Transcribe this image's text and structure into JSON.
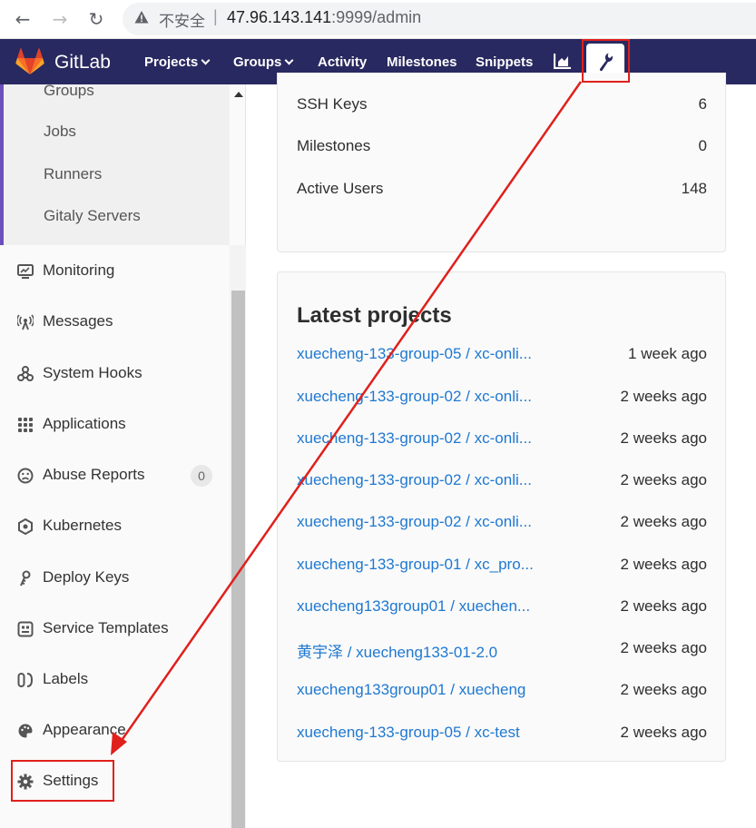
{
  "browser": {
    "insecure_label": "不安全",
    "separator": "|",
    "url_host": "47.96.143.141",
    "url_rest": ":9999/admin"
  },
  "header": {
    "brand": "GitLab",
    "nav": [
      {
        "label": "Projects",
        "has_caret": true
      },
      {
        "label": "Groups",
        "has_caret": true
      },
      {
        "label": "Activity"
      },
      {
        "label": "Milestones"
      },
      {
        "label": "Snippets"
      }
    ],
    "colors": {
      "background": "#292961",
      "logo_orange": "#e24329"
    }
  },
  "sidebar": {
    "sub_items": [
      "Groups",
      "Jobs",
      "Runners",
      "Gitaly Servers"
    ],
    "items": [
      {
        "label": "Monitoring",
        "icon": "monitor-icon"
      },
      {
        "label": "Messages",
        "icon": "broadcast-icon"
      },
      {
        "label": "System Hooks",
        "icon": "hook-icon"
      },
      {
        "label": "Applications",
        "icon": "grid-icon"
      },
      {
        "label": "Abuse Reports",
        "icon": "abuse-icon",
        "badge": "0"
      },
      {
        "label": "Kubernetes",
        "icon": "kubernetes-icon"
      },
      {
        "label": "Deploy Keys",
        "icon": "key-icon"
      },
      {
        "label": "Service Templates",
        "icon": "template-icon"
      },
      {
        "label": "Labels",
        "icon": "labels-icon"
      },
      {
        "label": "Appearance",
        "icon": "appearance-icon"
      },
      {
        "label": "Settings",
        "icon": "gear-icon"
      }
    ]
  },
  "stats": [
    {
      "label": "SSH Keys",
      "value": "6"
    },
    {
      "label": "Milestones",
      "value": "0"
    },
    {
      "label": "Active Users",
      "value": "148"
    }
  ],
  "latest_projects": {
    "title": "Latest projects",
    "rows": [
      {
        "name": "xuecheng-133-group-05 / xc-onli...",
        "time": "1 week ago"
      },
      {
        "name": "xuecheng-133-group-02 / xc-onli...",
        "time": "2 weeks ago"
      },
      {
        "name": "xuecheng-133-group-02 / xc-onli...",
        "time": "2 weeks ago"
      },
      {
        "name": "xuecheng-133-group-02 / xc-onli...",
        "time": "2 weeks ago"
      },
      {
        "name": "xuecheng-133-group-02 / xc-onli...",
        "time": "2 weeks ago"
      },
      {
        "name": "xuecheng-133-group-01 / xc_pro...",
        "time": "2 weeks ago"
      },
      {
        "name": "xuecheng133group01 / xuechen...",
        "time": "2 weeks ago"
      },
      {
        "name": "黄宇泽 / xuecheng133-01-2.0",
        "time": "2 weeks ago"
      },
      {
        "name": "xuecheng133group01 / xuecheng",
        "time": "2 weeks ago"
      },
      {
        "name": "xuecheng-133-group-05 / xc-test",
        "time": "2 weeks ago"
      }
    ]
  },
  "annotation": {
    "color": "#e0201c"
  }
}
